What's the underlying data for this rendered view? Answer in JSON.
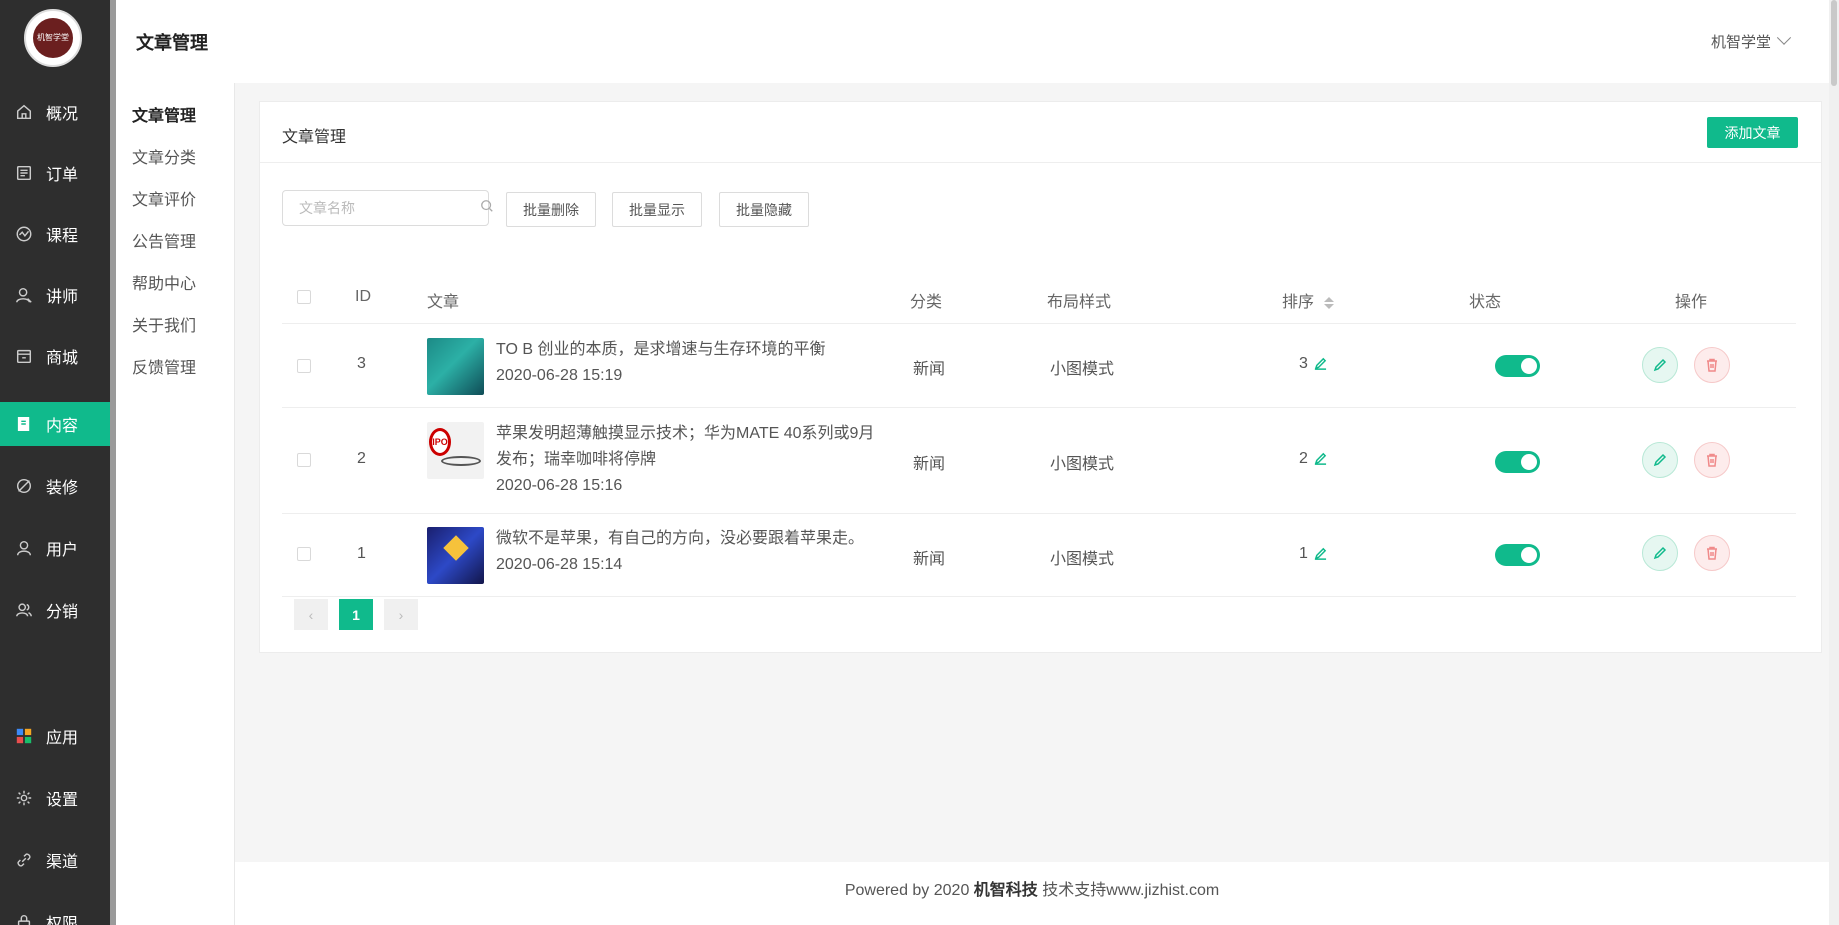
{
  "sidebar": {
    "logo_text": "机智学堂",
    "items": [
      {
        "label": "概况",
        "icon": "home-icon"
      },
      {
        "label": "订单",
        "icon": "order-icon"
      },
      {
        "label": "课程",
        "icon": "course-icon"
      },
      {
        "label": "讲师",
        "icon": "teacher-icon"
      },
      {
        "label": "商城",
        "icon": "shop-icon"
      },
      {
        "label": "内容",
        "icon": "content-icon",
        "active": true
      },
      {
        "label": "装修",
        "icon": "decorate-icon"
      },
      {
        "label": "用户",
        "icon": "user-icon"
      },
      {
        "label": "分销",
        "icon": "distribution-icon"
      },
      {
        "label": "应用",
        "icon": "apps-icon"
      },
      {
        "label": "设置",
        "icon": "settings-icon"
      },
      {
        "label": "渠道",
        "icon": "channel-icon"
      },
      {
        "label": "权限",
        "icon": "permission-icon"
      }
    ]
  },
  "header": {
    "title": "文章管理",
    "user": "机智学堂"
  },
  "submenu": {
    "items": [
      {
        "label": "文章管理",
        "active": true
      },
      {
        "label": "文章分类"
      },
      {
        "label": "文章评价"
      },
      {
        "label": "公告管理"
      },
      {
        "label": "帮助中心"
      },
      {
        "label": "关于我们"
      },
      {
        "label": "反馈管理"
      }
    ]
  },
  "card": {
    "title": "文章管理",
    "add_label": "添加文章",
    "search_placeholder": "文章名称",
    "batch_delete": "批量删除",
    "batch_show": "批量显示",
    "batch_hide": "批量隐藏"
  },
  "table": {
    "columns": {
      "id": "ID",
      "article": "文章",
      "category": "分类",
      "layout": "布局样式",
      "sort": "排序",
      "status": "状态",
      "ops": "操作"
    },
    "rows": [
      {
        "id": "3",
        "title": "TO B 创业的本质，是求增速与生存环境的平衡",
        "date": "2020-06-28 15:19",
        "category": "新闻",
        "layout": "小图模式",
        "sort": "3",
        "status": true
      },
      {
        "id": "2",
        "title": "苹果发明超薄触摸显示技术；华为MATE 40系列或9月发布；瑞幸咖啡将停牌",
        "date": "2020-06-28 15:16",
        "category": "新闻",
        "layout": "小图模式",
        "sort": "2",
        "status": true
      },
      {
        "id": "1",
        "title": "微软不是苹果，有自己的方向，没必要跟着苹果走。",
        "date": "2020-06-28 15:14",
        "category": "新闻",
        "layout": "小图模式",
        "sort": "1",
        "status": true
      }
    ]
  },
  "pagination": {
    "current": "1",
    "prev": "‹",
    "next": "›"
  },
  "footer": {
    "prefix": "Powered by 2020 ",
    "brand": "机智科技",
    "suffix": " 技术支持www.jizhist.com"
  },
  "colors": {
    "accent": "#10ba8c",
    "sidebar_bg": "#2e2e2e"
  }
}
